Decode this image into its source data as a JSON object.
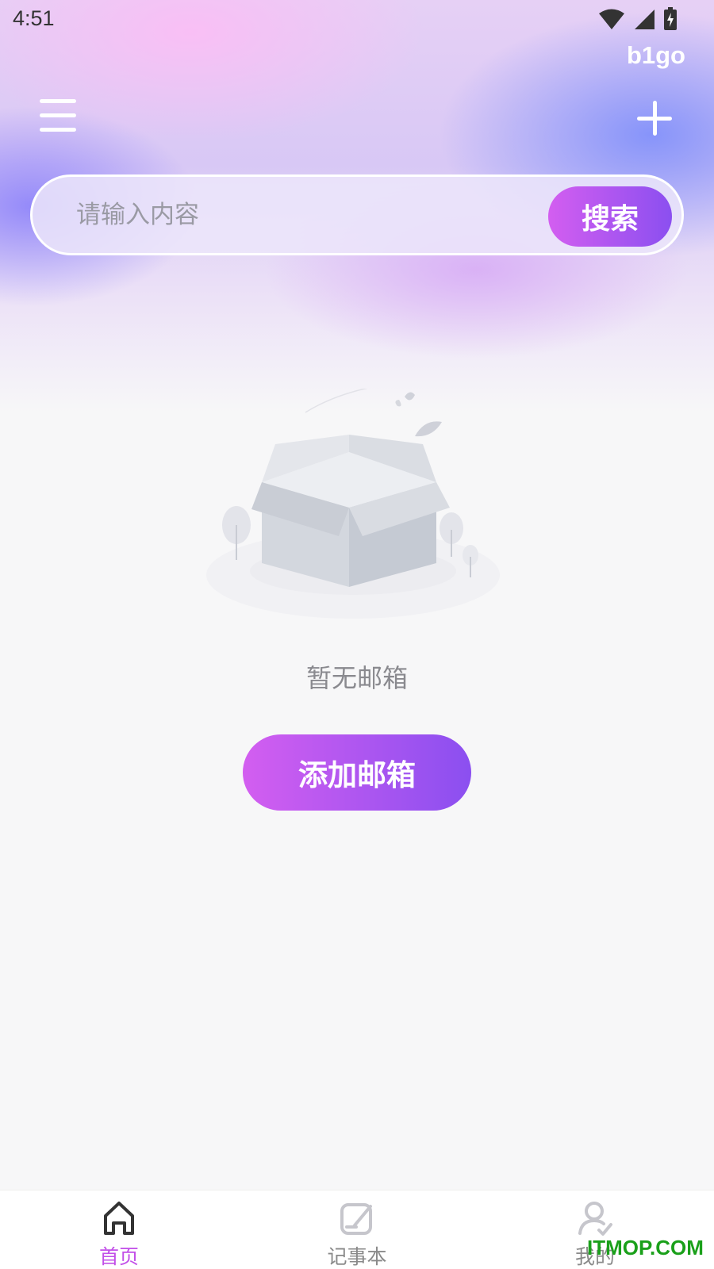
{
  "status_bar": {
    "time": "4:51"
  },
  "header": {
    "app_tag": "b1go"
  },
  "search": {
    "placeholder": "请输入内容",
    "button_label": "搜索"
  },
  "empty_state": {
    "message": "暂无邮箱",
    "add_button_label": "添加邮箱"
  },
  "tabs": [
    {
      "label": "首页",
      "icon": "home-icon",
      "active": true
    },
    {
      "label": "记事本",
      "icon": "notebook-icon",
      "active": false
    },
    {
      "label": "我的",
      "icon": "profile-icon",
      "active": false
    }
  ],
  "watermark": "ITMOP.COM",
  "colors": {
    "accent_start": "#d35ef0",
    "accent_end": "#8b4ff0",
    "active_tab": "#c24fe8",
    "background": "#f7f7f8"
  }
}
